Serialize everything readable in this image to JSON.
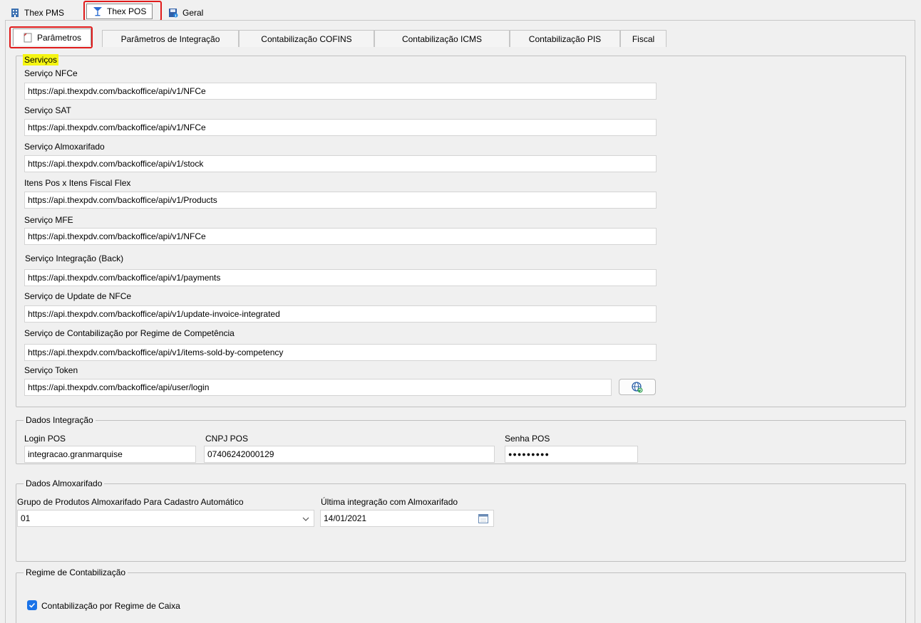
{
  "top_tabs": [
    {
      "label": "Thex PMS",
      "icon": "building-icon"
    },
    {
      "label": "Thex POS",
      "icon": "cocktail-glass-icon"
    },
    {
      "label": "Geral",
      "icon": "save-info-icon"
    }
  ],
  "inner_tabs": [
    "Parâmetros",
    "Parâmetros de Integração",
    "Contabilização COFINS",
    "Contabilização ICMS",
    "Contabilização PIS",
    "Fiscal"
  ],
  "servicos": {
    "title": "Serviços",
    "fields": [
      {
        "label": "Serviço NFCe",
        "value": "https://api.thexpdv.com/backoffice/api/v1/NFCe"
      },
      {
        "label": "Serviço SAT",
        "value": "https://api.thexpdv.com/backoffice/api/v1/NFCe"
      },
      {
        "label": "Serviço Almoxarifado",
        "value": "https://api.thexpdv.com/backoffice/api/v1/stock"
      },
      {
        "label": "Itens Pos x Itens Fiscal Flex",
        "value": "https://api.thexpdv.com/backoffice/api/v1/Products"
      },
      {
        "label": "Serviço MFE",
        "value": "https://api.thexpdv.com/backoffice/api/v1/NFCe"
      },
      {
        "label": "Serviço Integração (Back)",
        "value": "https://api.thexpdv.com/backoffice/api/v1/payments"
      },
      {
        "label": "Serviço de Update de NFCe",
        "value": "https://api.thexpdv.com/backoffice/api/v1/update-invoice-integrated"
      },
      {
        "label": "Serviço de Contabilização por Regime de Competência",
        "value": "https://api.thexpdv.com/backoffice/api/v1/items-sold-by-competency"
      },
      {
        "label": "Serviço Token",
        "value": "https://api.thexpdv.com/backoffice/api/user/login"
      }
    ],
    "token_button_icon": "globe-refresh-icon"
  },
  "dados_integracao": {
    "title": "Dados Integração",
    "login_label": "Login POS",
    "login_value": "integracao.granmarquise",
    "cnpj_label": "CNPJ POS",
    "cnpj_value": "07406242000129",
    "senha_label": "Senha POS",
    "senha_value": "●●●●●●●●●"
  },
  "dados_almoxarifado": {
    "title": "Dados Almoxarifado",
    "grupo_label": "Grupo de Produtos Almoxarifado Para Cadastro Automático",
    "grupo_value": "01",
    "ultima_label": "Última integração com Almoxarifado",
    "ultima_value": "14/01/2021"
  },
  "regime": {
    "title": "Regime de Contabilização",
    "checkbox_label": "Contabilização por Regime de Caixa",
    "checked": true
  },
  "colors": {
    "highlight": "#f5f511",
    "annotation": "#e01b1b",
    "checkbox": "#1a73e8"
  }
}
